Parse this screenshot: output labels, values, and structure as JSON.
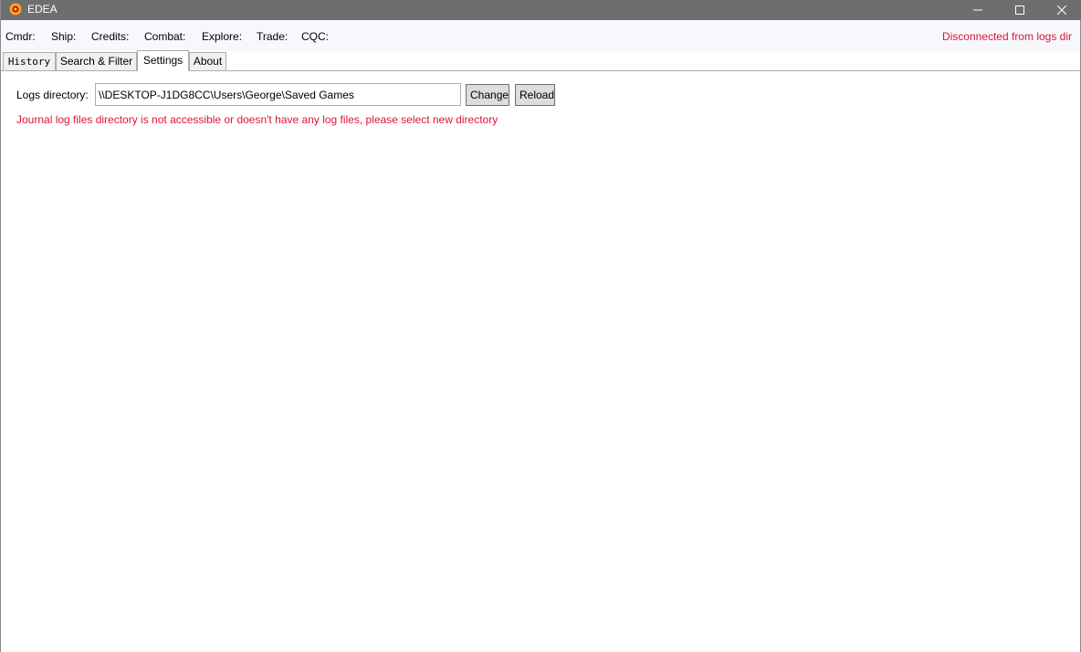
{
  "window": {
    "title": "EDEA",
    "controls": {
      "minimize": "minimize-icon",
      "maximize": "maximize-icon",
      "close": "close-icon"
    }
  },
  "stats": {
    "cmdr": "Cmdr:",
    "ship": "Ship:",
    "credits": "Credits:",
    "combat": "Combat:",
    "explore": "Explore:",
    "trade": "Trade:",
    "cqc": "CQC:"
  },
  "status": {
    "text": "Disconnected from logs dir",
    "color": "#dc143c"
  },
  "tabs": [
    {
      "label": "History"
    },
    {
      "label": "Search & Filter"
    },
    {
      "label": "Settings",
      "active": true
    },
    {
      "label": "About"
    }
  ],
  "settings": {
    "logs_label": "Logs directory:",
    "logs_value": "\\\\DESKTOP-J1DG8CC\\Users\\George\\Saved Games",
    "change_label": "Change",
    "reload_label": "Reload",
    "error_message": "Journal log files directory is not accessible or doesn't have any log files, please select new directory"
  },
  "colors": {
    "titlebar": "#6e6e6e",
    "error": "#dc143c",
    "button_bg": "#dddddd"
  }
}
